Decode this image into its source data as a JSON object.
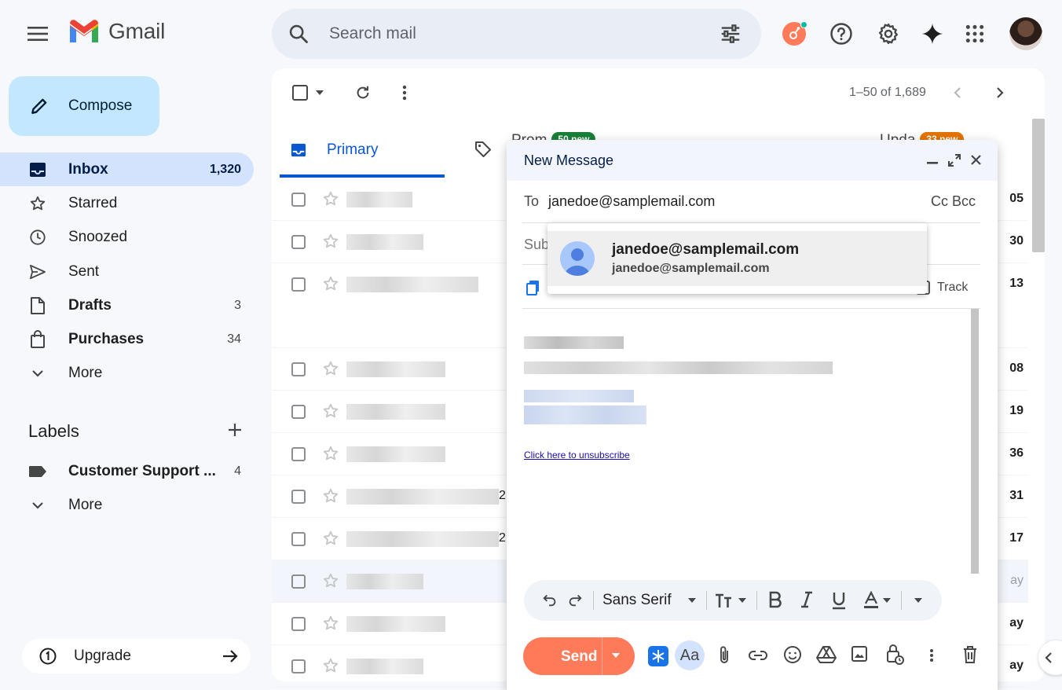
{
  "app": {
    "name": "Gmail"
  },
  "search": {
    "placeholder": "Search mail"
  },
  "sidebar": {
    "compose_label": "Compose",
    "items": [
      {
        "label": "Inbox",
        "count": "1,320"
      },
      {
        "label": "Starred",
        "count": ""
      },
      {
        "label": "Snoozed",
        "count": ""
      },
      {
        "label": "Sent",
        "count": ""
      },
      {
        "label": "Drafts",
        "count": "3"
      },
      {
        "label": "Purchases",
        "count": "34"
      },
      {
        "label": "More",
        "count": ""
      }
    ],
    "labels_heading": "Labels",
    "labels": [
      {
        "label": "Customer Support ...",
        "count": "4"
      }
    ],
    "labels_more": "More",
    "upgrade_label": "Upgrade"
  },
  "mail": {
    "pager": "1–50 of 1,689",
    "tabs": [
      {
        "label": "Primary"
      },
      {
        "label": "Prom",
        "badge": "50 new",
        "badge_color": "#188038"
      },
      {
        "label": "Upda",
        "badge": "33 new",
        "badge_color": "#e37400"
      }
    ],
    "rows": [
      {
        "time": "05"
      },
      {
        "time": "30"
      },
      {
        "time": "13"
      },
      {
        "time": "08"
      },
      {
        "time": "19"
      },
      {
        "time": "36"
      },
      {
        "time": "31"
      },
      {
        "time": "17"
      },
      {
        "time": "ay"
      },
      {
        "time": "ay"
      },
      {
        "time": "ay"
      }
    ],
    "row_snippet_char": "2"
  },
  "compose": {
    "title": "New Message",
    "to_label": "To",
    "to_value": "janedoe@samplemail.com",
    "cc_bcc": "Cc Bcc",
    "subject_placeholder": "Sub",
    "track_label": "Track",
    "unsubscribe_link": "Click here to unsubscribe",
    "font_name": "Sans Serif",
    "send_label": "Send",
    "aa_label": "Aa",
    "suggestion": {
      "name": "janedoe@samplemail.com",
      "email": "janedoe@samplemail.com"
    }
  },
  "colors": {
    "accent": "#0b57d0",
    "compose_bg": "#c2e7ff",
    "active_nav": "#d3e3fd",
    "send": "#ff7a59"
  }
}
